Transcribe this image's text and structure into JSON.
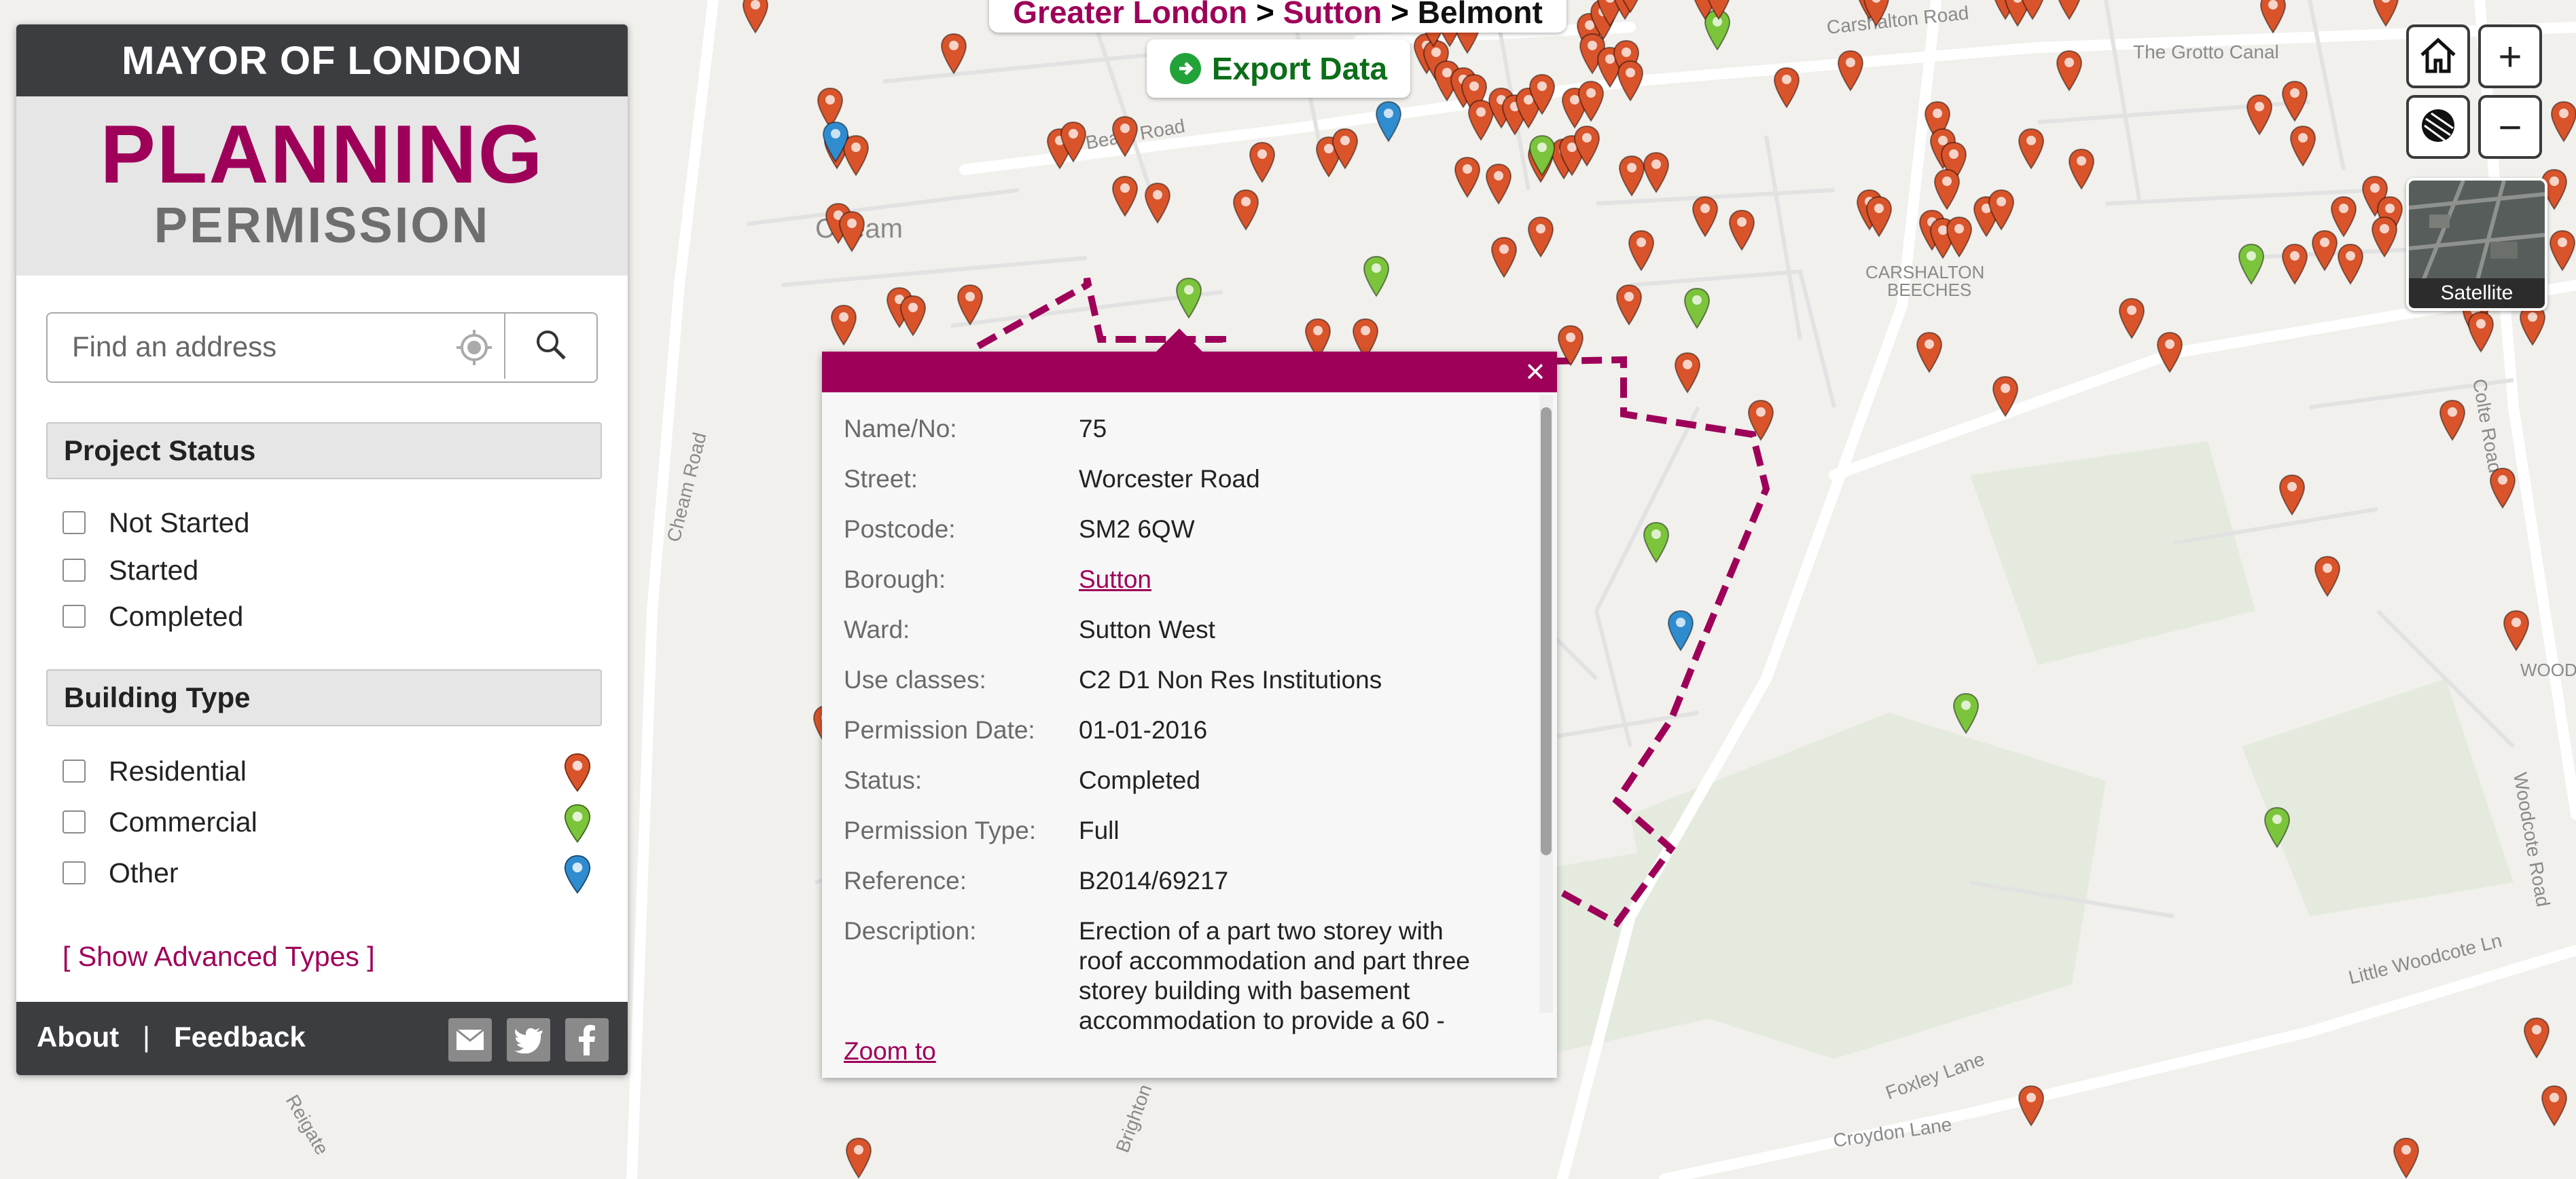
{
  "panel": {
    "header": "MAYOR OF LONDON",
    "title_line1": "PLANNING",
    "title_line2": "PERMISSION",
    "search": {
      "placeholder": "Find an address"
    },
    "project_status": {
      "heading": "Project Status",
      "options": [
        "Not Started",
        "Started",
        "Completed"
      ]
    },
    "building_type": {
      "heading": "Building Type",
      "options": [
        {
          "label": "Residential",
          "color": "#d9542b"
        },
        {
          "label": "Commercial",
          "color": "#7bc43b"
        },
        {
          "label": "Other",
          "color": "#2f8ccf"
        }
      ]
    },
    "advanced_link": "[ Show Advanced Types ]",
    "footer": {
      "about": "About",
      "separator": "|",
      "feedback": "Feedback",
      "social": [
        "email-icon",
        "twitter-icon",
        "facebook-icon"
      ]
    }
  },
  "breadcrumb": {
    "items": [
      "Greater London",
      "Sutton",
      "Belmont"
    ],
    "separator": ">"
  },
  "export_button": "Export Data",
  "popup": {
    "fields": [
      {
        "key": "Name/No:",
        "value": "75"
      },
      {
        "key": "Street:",
        "value": "Worcester Road"
      },
      {
        "key": "Postcode:",
        "value": "SM2 6QW"
      },
      {
        "key": "Borough:",
        "value": "Sutton",
        "link": true
      },
      {
        "key": "Ward:",
        "value": "Sutton West"
      },
      {
        "key": "Use classes:",
        "value": "C2 D1 Non Res Institutions"
      },
      {
        "key": "Permission Date:",
        "value": "01-01-2016"
      },
      {
        "key": "Status:",
        "value": "Completed"
      },
      {
        "key": "Permission Type:",
        "value": "Full"
      },
      {
        "key": "Reference:",
        "value": "B2014/69217"
      }
    ],
    "description_key": "Description:",
    "description_lines": [
      "Erection of a part two storey with",
      "roof accommodation and part three",
      "storey building with basement",
      "accommodation to provide a 60 -"
    ],
    "zoom_link": "Zoom to",
    "close": "×"
  },
  "controls": {
    "home": "home-icon",
    "zoom_in": "+",
    "zoom_out": "−",
    "basemap": "basemap-toggle-icon",
    "satellite_label": "Satellite"
  },
  "map_labels": [
    "Cheam",
    "Carshalton Road",
    "The Grotto Canal",
    "CARSHALTON BEECHES",
    "Cheam Road",
    "Brighton",
    "Reigate",
    "WOODCOTE",
    "Woodcote Road",
    "Little Woodcote Ln",
    "Foxley Lane",
    "Croydon Lane",
    "Beam Road",
    "Colte Road"
  ],
  "pin_colors": {
    "residential": "#d9542b",
    "commercial": "#7bc43b",
    "other": "#2f8ccf"
  }
}
